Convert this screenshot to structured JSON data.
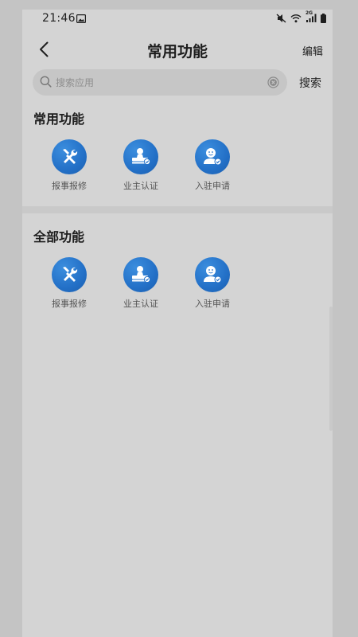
{
  "status_bar": {
    "time": "21:46",
    "icons": [
      "image-icon",
      "mute-icon",
      "wifi-icon",
      "signal-icon",
      "battery-icon"
    ],
    "network_label": "2G"
  },
  "header": {
    "title": "常用功能",
    "back_icon": "chevron-left-icon",
    "edit_label": "编辑"
  },
  "search": {
    "placeholder": "搜索应用",
    "value": "",
    "button_label": "搜索"
  },
  "sections": [
    {
      "title": "常用功能",
      "items": [
        {
          "label": "报事报修",
          "icon": "repair-tools-icon"
        },
        {
          "label": "业主认证",
          "icon": "owner-stamp-icon"
        },
        {
          "label": "入驻申请",
          "icon": "resident-check-icon"
        }
      ]
    },
    {
      "title": "全部功能",
      "items": [
        {
          "label": "报事报修",
          "icon": "repair-tools-icon"
        },
        {
          "label": "业主认证",
          "icon": "owner-stamp-icon"
        },
        {
          "label": "入驻申请",
          "icon": "resident-check-icon"
        }
      ]
    }
  ],
  "colors": {
    "icon_blue": "#2370c7",
    "text_primary": "#1e1e1e",
    "text_secondary": "#555555"
  }
}
